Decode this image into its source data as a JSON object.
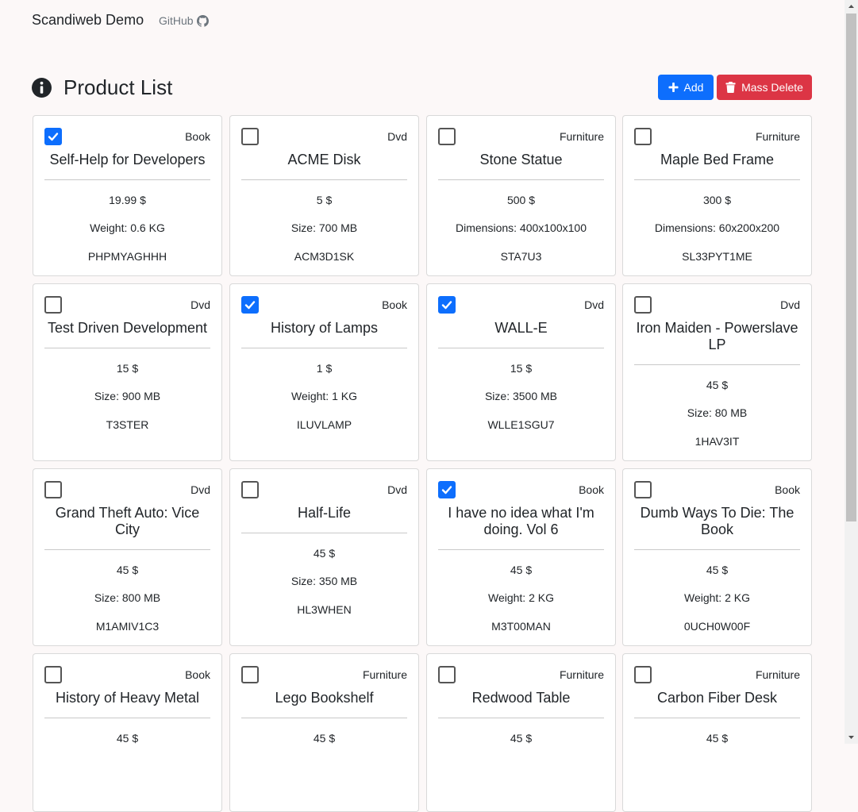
{
  "nav": {
    "brand": "Scandiweb Demo",
    "github": "GitHub"
  },
  "header": {
    "title": "Product List",
    "add_label": "Add",
    "mass_delete_label": "Mass Delete"
  },
  "colors": {
    "primary": "#0d6efd",
    "danger": "#dc3545",
    "background": "#fcf8f8"
  },
  "products": [
    {
      "checked": true,
      "type": "Book",
      "name": "Self-Help for Developers",
      "price": "19.99 $",
      "attr": "Weight: 0.6 KG",
      "sku": "PHPMYAGHHH"
    },
    {
      "checked": false,
      "type": "Dvd",
      "name": "ACME Disk",
      "price": "5 $",
      "attr": "Size: 700 MB",
      "sku": "ACM3D1SK"
    },
    {
      "checked": false,
      "type": "Furniture",
      "name": "Stone Statue",
      "price": "500 $",
      "attr": "Dimensions: 400x100x100",
      "sku": "STA7U3"
    },
    {
      "checked": false,
      "type": "Furniture",
      "name": "Maple Bed Frame",
      "price": "300 $",
      "attr": "Dimensions: 60x200x200",
      "sku": "SL33PYT1ME"
    },
    {
      "checked": false,
      "type": "Dvd",
      "name": "Test Driven Development",
      "price": "15 $",
      "attr": "Size: 900 MB",
      "sku": "T3STER"
    },
    {
      "checked": true,
      "type": "Book",
      "name": "History of Lamps",
      "price": "1 $",
      "attr": "Weight: 1 KG",
      "sku": "ILUVLAMP"
    },
    {
      "checked": true,
      "type": "Dvd",
      "name": "WALL-E",
      "price": "15 $",
      "attr": "Size: 3500 MB",
      "sku": "WLLE1SGU7"
    },
    {
      "checked": false,
      "type": "Dvd",
      "name": "Iron Maiden - Powerslave LP",
      "price": "45 $",
      "attr": "Size: 80 MB",
      "sku": "1HAV3IT"
    },
    {
      "checked": false,
      "type": "Dvd",
      "name": "Grand Theft Auto: Vice City",
      "price": "45 $",
      "attr": "Size: 800 MB",
      "sku": "M1AMIV1C3"
    },
    {
      "checked": false,
      "type": "Dvd",
      "name": "Half-Life",
      "price": "45 $",
      "attr": "Size: 350 MB",
      "sku": "HL3WHEN"
    },
    {
      "checked": true,
      "type": "Book",
      "name": "I have no idea what I'm doing. Vol 6",
      "price": "45 $",
      "attr": "Weight: 2 KG",
      "sku": "M3T00MAN"
    },
    {
      "checked": false,
      "type": "Book",
      "name": "Dumb Ways To Die: The Book",
      "price": "45 $",
      "attr": "Weight: 2 KG",
      "sku": "0UCH0W00F"
    },
    {
      "checked": false,
      "type": "Book",
      "name": "History of Heavy Metal",
      "price": "45 $",
      "attr": "",
      "sku": ""
    },
    {
      "checked": false,
      "type": "Furniture",
      "name": "Lego Bookshelf",
      "price": "45 $",
      "attr": "",
      "sku": ""
    },
    {
      "checked": false,
      "type": "Furniture",
      "name": "Redwood Table",
      "price": "45 $",
      "attr": "",
      "sku": ""
    },
    {
      "checked": false,
      "type": "Furniture",
      "name": "Carbon Fiber Desk",
      "price": "45 $",
      "attr": "",
      "sku": ""
    }
  ]
}
